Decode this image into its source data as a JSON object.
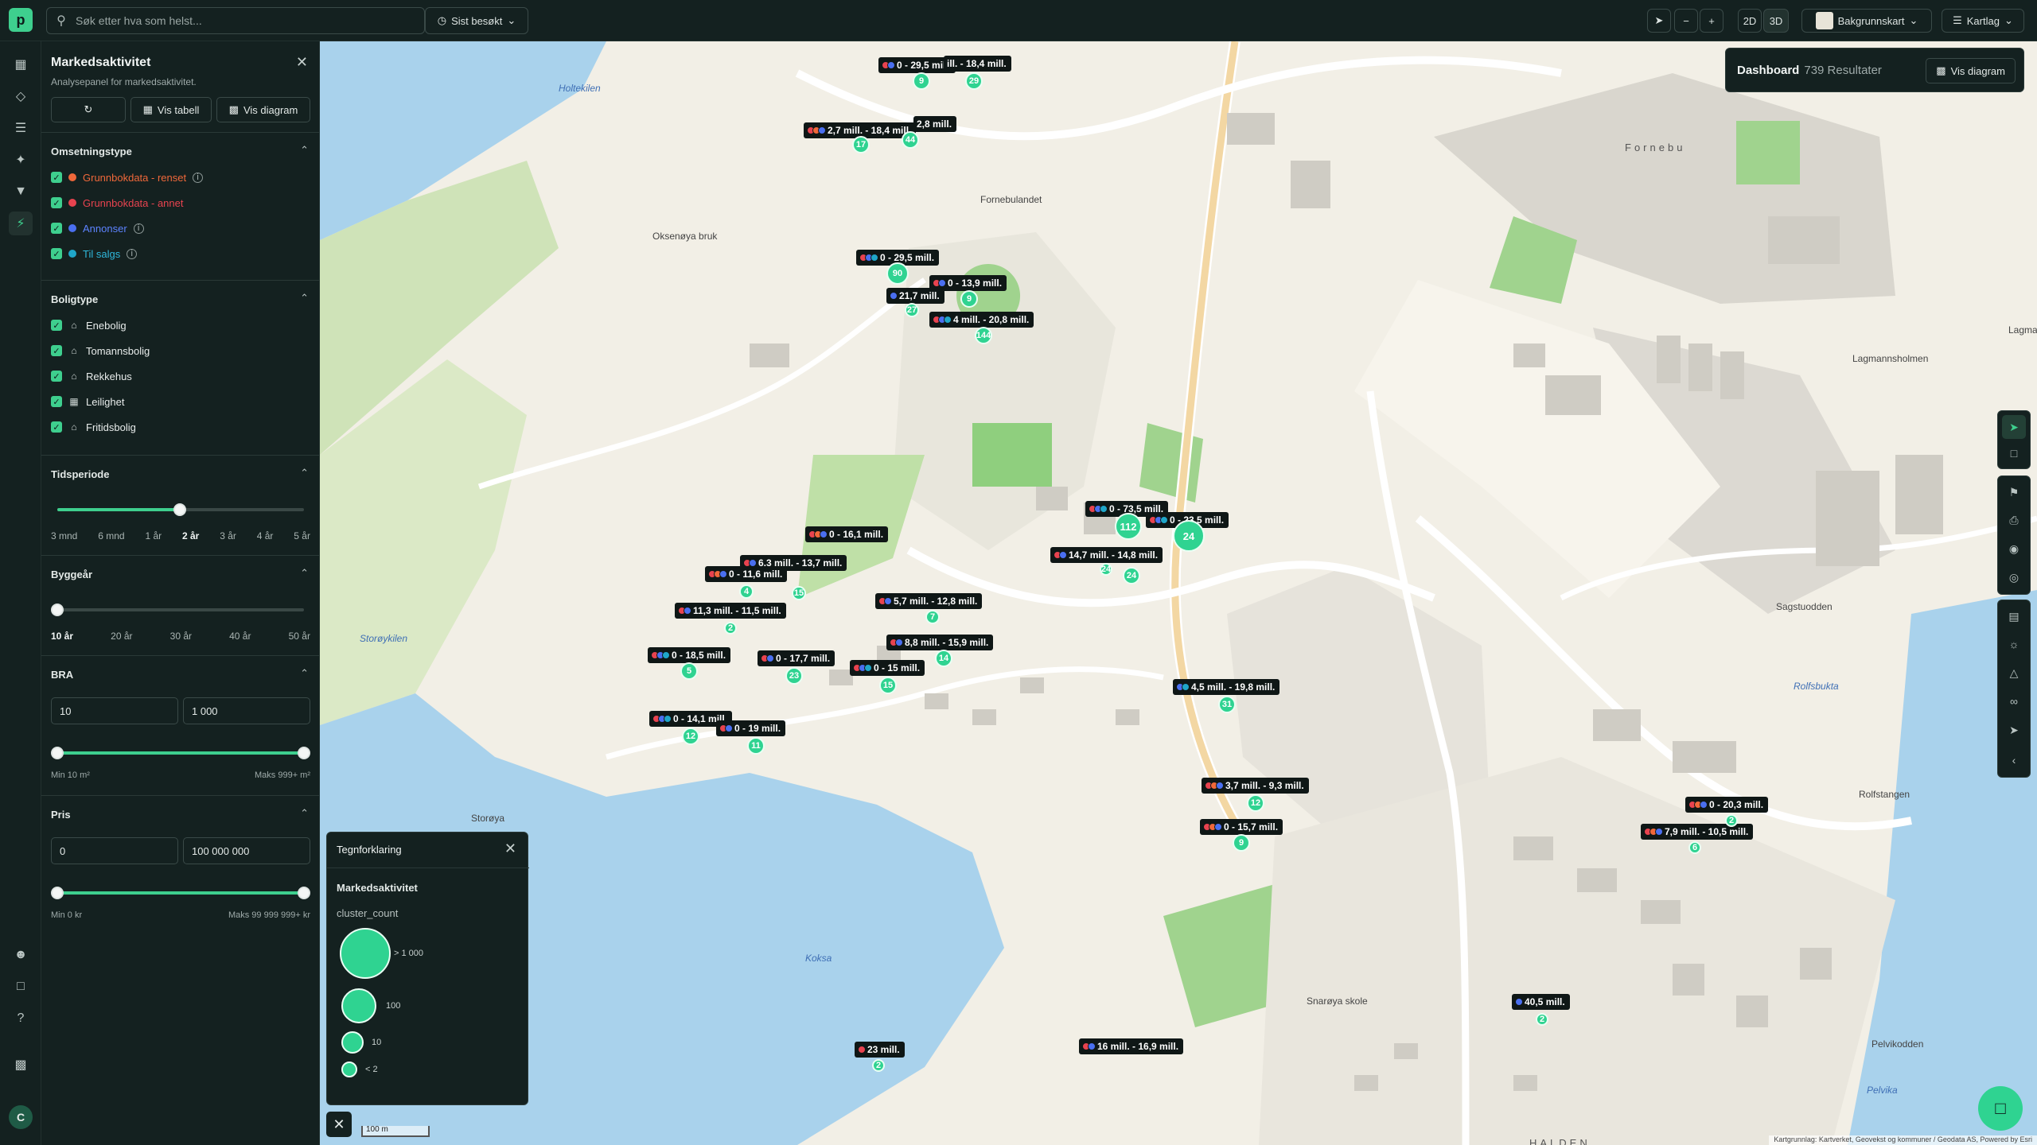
{
  "topbar": {
    "logo": "p",
    "search_placeholder": "Søk etter hva som helst...",
    "recent_label": "Sist besøkt",
    "view_2d": "2D",
    "view_3d": "3D",
    "basemap_label": "Bakgrunnskart",
    "layers_label": "Kartlag",
    "minus": "−",
    "plus": "+"
  },
  "panel": {
    "title": "Markedsaktivitet",
    "subtitle": "Analysepanel for markedsaktivitet.",
    "btn_table": "Vis tabell",
    "btn_chart": "Vis diagram",
    "turnover": {
      "title": "Omsetningstype",
      "items": [
        {
          "label": "Grunnbokdata - renset",
          "color": "#f0683a"
        },
        {
          "label": "Grunnbokdata - annet",
          "color": "#e8434f"
        },
        {
          "label": "Annonser",
          "color": "#4a6ff0"
        },
        {
          "label": "Til salgs",
          "color": "#1fa6c9"
        }
      ]
    },
    "housing": {
      "title": "Boligtype",
      "items": [
        "Enebolig",
        "Tomannsbolig",
        "Rekkehus",
        "Leilighet",
        "Fritidsbolig"
      ]
    },
    "period": {
      "title": "Tidsperiode",
      "ticks": [
        "3 mnd",
        "6 mnd",
        "1 år",
        "2 år",
        "3 år",
        "4 år",
        "5 år"
      ],
      "selected": "2 år"
    },
    "built": {
      "title": "Byggeår",
      "ticks": [
        "10 år",
        "20 år",
        "30 år",
        "40 år",
        "50 år"
      ],
      "selected": "10 år"
    },
    "bra": {
      "title": "BRA",
      "min_value": "10",
      "max_value": "1 000",
      "min_label": "Min 10 m²",
      "max_label": "Maks 999+ m²"
    },
    "price": {
      "title": "Pris",
      "min_value": "0",
      "max_value": "100 000 000",
      "min_label": "Min 0 kr",
      "max_label": "Maks 99 999 999+ kr"
    }
  },
  "dashboard": {
    "title": "Dashboard",
    "count": "739 Resultater",
    "btn": "Vis diagram"
  },
  "legend": {
    "title": "Tegnforklaring",
    "section": "Markedsaktivitet",
    "key": "cluster_count",
    "items": [
      "> 1 000",
      "100",
      "10",
      "< 2"
    ]
  },
  "map": {
    "scale": "100 m",
    "attribution": "Kartgrunnlag: Kartverket, Geovekst og kommuner / Geodata AS, Powered by Esri",
    "places": [
      "Holtekilen",
      "Fornebu",
      "Fornebulandet",
      "Oksenøya bruk",
      "Storøykilen",
      "Storøya",
      "Koksa",
      "Rolfsbukta",
      "Sagstuodden",
      "Lagmannsholmen",
      "Rolfstangen",
      "Pelvikodden",
      "Pelvika",
      "Snarøya skole",
      "Lagma",
      "HALDEN"
    ],
    "labels": [
      {
        "text": "0 - 29,5 mill.",
        "c": [
          "#e8434f",
          "#4a6ff0"
        ]
      },
      {
        "text": "ill. - 18,4 mill.",
        "c": []
      },
      {
        "text": "2,7 mill. - 18,4 mill.",
        "c": [
          "#e8434f",
          "#f0683a",
          "#4a6ff0"
        ]
      },
      {
        "text": "2,8 mill.",
        "c": []
      },
      {
        "text": "0 - 29,5 mill.",
        "c": [
          "#e8434f",
          "#4a6ff0",
          "#1fa6c9"
        ]
      },
      {
        "text": "0 - 13,9 mill.",
        "c": [
          "#e8434f",
          "#4a6ff0"
        ]
      },
      {
        "text": "21,7 mill.",
        "c": [
          "#4a6ff0"
        ]
      },
      {
        "text": "4 mill. - 20,8 mill.",
        "c": [
          "#e8434f",
          "#4a6ff0",
          "#1fa6c9"
        ]
      },
      {
        "text": "0 - 73,5 mill.",
        "c": [
          "#e8434f",
          "#4a6ff0",
          "#1fa6c9"
        ]
      },
      {
        "text": "0 - 23,5 mill.",
        "c": [
          "#e8434f",
          "#4a6ff0",
          "#1fa6c9"
        ]
      },
      {
        "text": "14,7 mill. - 14,8 mill.",
        "c": [
          "#e8434f",
          "#4a6ff0"
        ]
      },
      {
        "text": "0 - 16,1 mill.",
        "c": [
          "#e8434f",
          "#f0683a",
          "#4a6ff0"
        ]
      },
      {
        "text": "6,3 mill. - 13,7 mill.",
        "c": [
          "#e8434f",
          "#4a6ff0"
        ]
      },
      {
        "text": "0 - 11,6 mill.",
        "c": [
          "#e8434f",
          "#f0683a",
          "#4a6ff0"
        ]
      },
      {
        "text": "5,7 mill. - 12,8 mill.",
        "c": [
          "#e8434f",
          "#4a6ff0"
        ]
      },
      {
        "text": "11,3 mill. - 11,5 mill.",
        "c": [
          "#e8434f",
          "#4a6ff0"
        ]
      },
      {
        "text": "8,8 mill. - 15,9 mill.",
        "c": [
          "#e8434f",
          "#4a6ff0"
        ]
      },
      {
        "text": "0 - 18,5 mill.",
        "c": [
          "#e8434f",
          "#4a6ff0",
          "#1fa6c9"
        ]
      },
      {
        "text": "0 - 17,7 mill.",
        "c": [
          "#e8434f",
          "#4a6ff0"
        ]
      },
      {
        "text": "0 - 15 mill.",
        "c": [
          "#e8434f",
          "#4a6ff0",
          "#1fa6c9"
        ]
      },
      {
        "text": "4,5 mill. - 19,8 mill.",
        "c": [
          "#4a6ff0",
          "#1fa6c9"
        ]
      },
      {
        "text": "0 - 14,1 mill.",
        "c": [
          "#e8434f",
          "#4a6ff0",
          "#1fa6c9"
        ]
      },
      {
        "text": "0 - 19 mill.",
        "c": [
          "#e8434f",
          "#4a6ff0"
        ]
      },
      {
        "text": "3,7 mill. - 9,3 mill.",
        "c": [
          "#e8434f",
          "#f0683a",
          "#4a6ff0"
        ]
      },
      {
        "text": "0 - 15,7 mill.",
        "c": [
          "#e8434f",
          "#f0683a",
          "#4a6ff0"
        ]
      },
      {
        "text": "0 - 20,3 mill.",
        "c": [
          "#e8434f",
          "#f0683a",
          "#4a6ff0"
        ]
      },
      {
        "text": "7,9 mill. - 10,5 mill.",
        "c": [
          "#e8434f",
          "#f0683a",
          "#4a6ff0"
        ]
      },
      {
        "text": "40,5 mill.",
        "c": [
          "#4a6ff0"
        ]
      },
      {
        "text": "23 mill.",
        "c": [
          "#e8434f"
        ]
      },
      {
        "text": "16 mill. - 16,9 mill.",
        "c": [
          "#e8434f",
          "#4a6ff0"
        ]
      }
    ],
    "clusters": [
      "9",
      "29",
      "17",
      "44",
      "90",
      "9",
      "27",
      "144",
      "112",
      "24",
      "24",
      "24",
      "15",
      "4",
      "7",
      "2",
      "14",
      "5",
      "23",
      "15",
      "31",
      "12",
      "11",
      "12",
      "9",
      "2",
      "6",
      "2",
      "2"
    ]
  }
}
